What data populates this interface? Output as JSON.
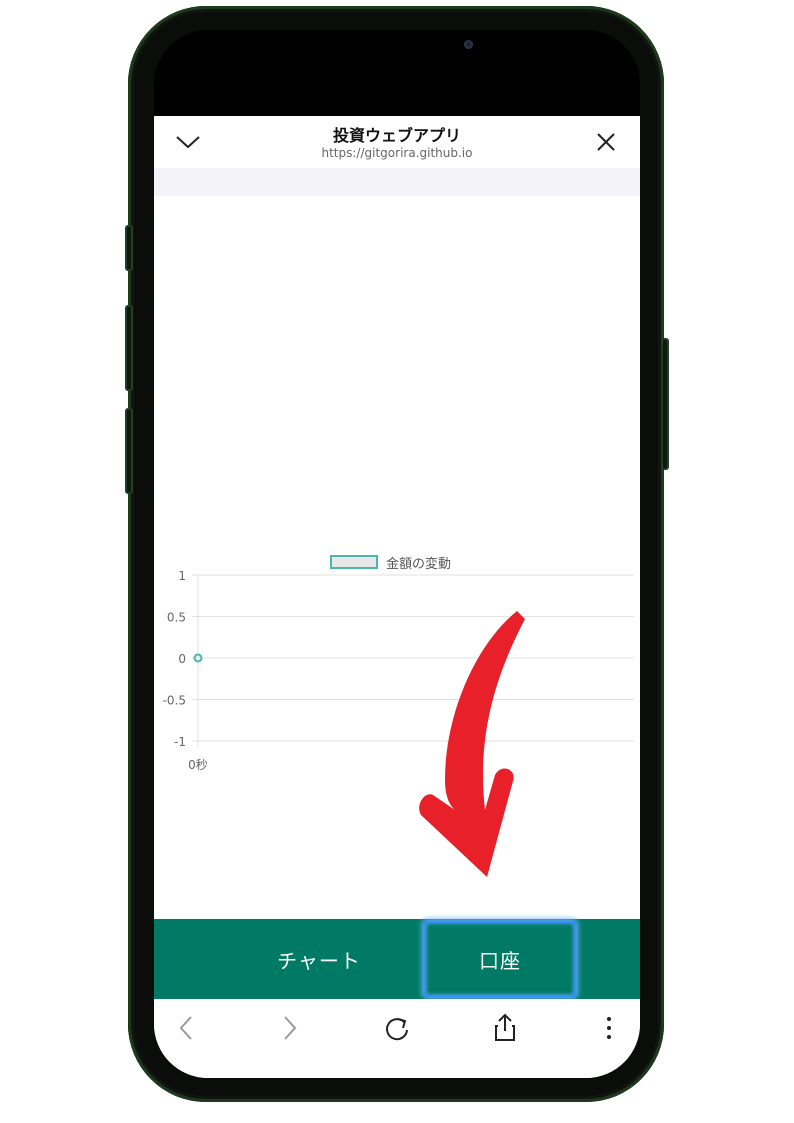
{
  "browser": {
    "title": "投資ウェブアプリ",
    "url": "https://gitgorira.github.io",
    "close_icon": "close-icon",
    "collapse_icon": "chevron-down-icon"
  },
  "chart_data": {
    "type": "line",
    "legend": [
      "金額の変動"
    ],
    "legend_color": "#4db6ac",
    "series": [
      {
        "name": "金額の変動",
        "x": [
          "0秒"
        ],
        "values": [
          0
        ]
      }
    ],
    "x_ticks": [
      "0秒"
    ],
    "y_ticks": [
      "1",
      "0.5",
      "0",
      "-0.5",
      "-1"
    ],
    "ylim": [
      -1,
      1
    ],
    "grid": true,
    "legend_position": "top-center"
  },
  "tabs": [
    {
      "label": "チャート"
    },
    {
      "label": "口座"
    }
  ],
  "colors": {
    "tab_bar": "#007a64",
    "highlight": "#3a8cff",
    "arrow": "#e8202a"
  },
  "nav": {
    "back_icon": "back-icon",
    "forward_icon": "forward-icon",
    "reload_icon": "reload-icon",
    "share_icon": "share-icon",
    "more_icon": "more-icon"
  }
}
